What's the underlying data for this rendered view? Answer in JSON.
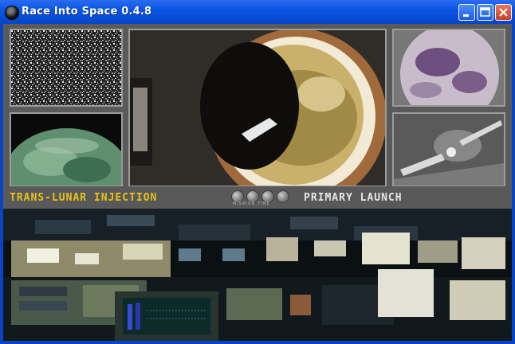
{
  "window": {
    "title": "Race Into Space 0.4.8",
    "controls": [
      "minimize",
      "maximize",
      "close"
    ]
  },
  "mission": {
    "phase_left": "TRANS-LUNAR INJECTION",
    "phase_right": "PRIMARY LAUNCH",
    "mission_time_label": "MISSION TIME"
  },
  "colors": {
    "phase_left": "#e7c21b",
    "phase_right": "#e6e6e6",
    "titlebar": "#0a55e6"
  }
}
